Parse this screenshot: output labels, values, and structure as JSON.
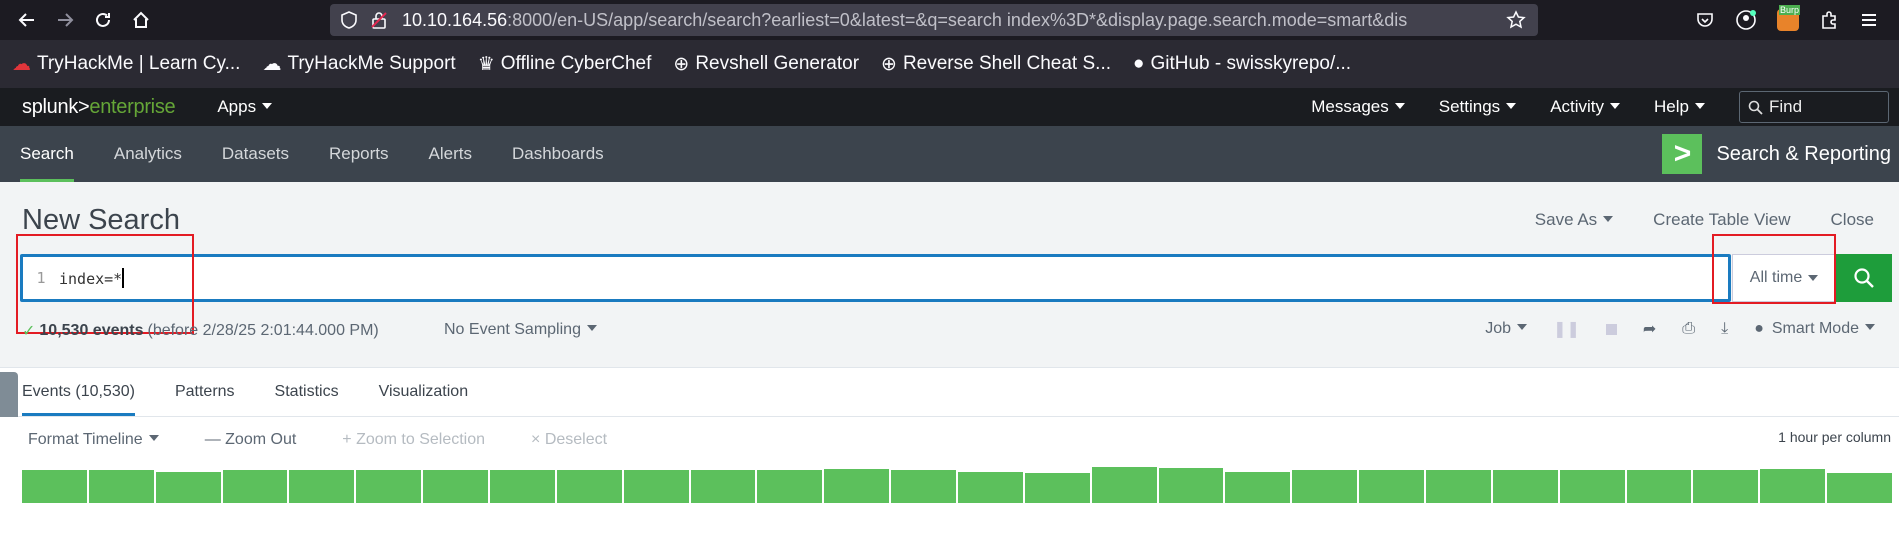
{
  "browser": {
    "url_host": "10.10.164.56",
    "url_rest": ":8000/en-US/app/search/search?earliest=0&latest=&q=search index%3D*&display.page.search.mode=smart&dis",
    "bookmarks": [
      "TryHackMe | Learn Cy...",
      "TryHackMe Support",
      "Offline CyberChef",
      "Revshell Generator",
      "Reverse Shell Cheat S...",
      "GitHub - swisskyrepo/..."
    ],
    "burp_badge": "Burp"
  },
  "splunk": {
    "logo_left": "splunk>",
    "logo_right": "enterprise",
    "apps_label": "Apps",
    "menu": [
      "Messages",
      "Settings",
      "Activity",
      "Help"
    ],
    "find_placeholder": "Find"
  },
  "app_bar": {
    "tabs": [
      "Search",
      "Analytics",
      "Datasets",
      "Reports",
      "Alerts",
      "Dashboards"
    ],
    "title": "Search & Reporting",
    "logo_glyph": ">"
  },
  "search": {
    "page_title": "New Search",
    "save_as": "Save As",
    "create_table_view": "Create Table View",
    "close": "Close",
    "line_number": "1",
    "query": "index=*",
    "time_range": "All time",
    "event_count": "10,530 events",
    "event_detail": "(before 2/28/25 2:01:44.000 PM)",
    "sampling": "No Event Sampling",
    "job": "Job",
    "mode": "Smart Mode"
  },
  "results": {
    "tabs": [
      "Events (10,530)",
      "Patterns",
      "Statistics",
      "Visualization"
    ]
  },
  "timeline": {
    "format": "Format Timeline",
    "zoom_out": "— Zoom Out",
    "zoom_selection": "+ Zoom to Selection",
    "deselect": "× Deselect",
    "per_column": "1 hour per column",
    "bar_values": [
      32,
      32,
      30,
      32,
      32,
      32,
      32,
      32,
      32,
      32,
      32,
      32,
      33,
      32,
      30,
      29,
      35,
      34,
      30,
      32,
      32,
      32,
      32,
      32,
      32,
      32,
      33,
      29
    ],
    "bar_color": "#5cc05c"
  },
  "colors": {
    "accent_blue": "#1a7bc0",
    "accent_green": "#5cc05c",
    "highlight_red": "#e31b23"
  }
}
